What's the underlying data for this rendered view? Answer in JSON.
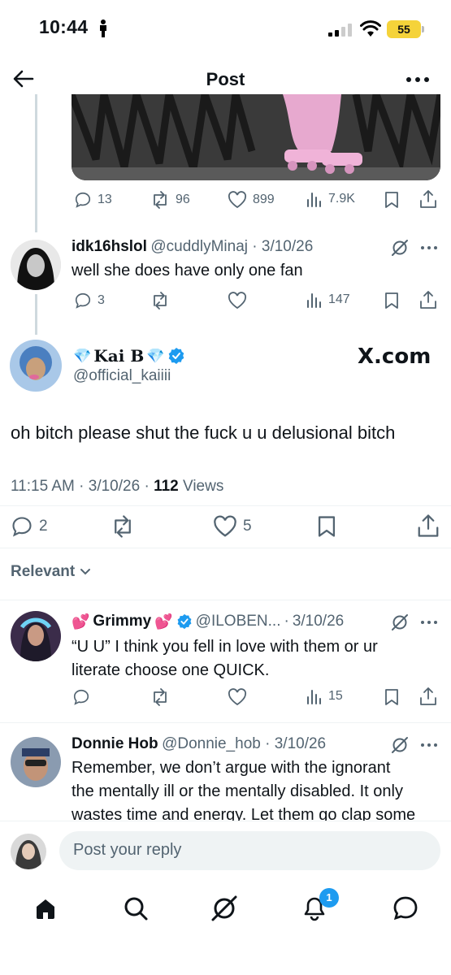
{
  "status_bar": {
    "time": "10:44",
    "battery": "55"
  },
  "nav": {
    "title": "Post"
  },
  "parent_actions": {
    "replies": "13",
    "reposts": "96",
    "likes": "899",
    "views": "7.9K"
  },
  "reply1": {
    "name": "idk16hslol",
    "handle": "@cuddlyMinaj",
    "date": "3/10/26",
    "text": "well she does have only one fan",
    "replies": "3",
    "views": "147"
  },
  "main_post": {
    "name": "Kai B",
    "handle": "@official_kaiiii",
    "watermark": "X.com",
    "text": "oh bitch please shut the fuck u u delusional bitch",
    "time": "11:15 AM",
    "date": "3/10/26",
    "views_count": "112",
    "views_label": "Views",
    "replies": "2",
    "likes": "5"
  },
  "sort": {
    "label": "Relevant"
  },
  "reply2": {
    "name": "Grimmy",
    "handle": "@ILOBEN...",
    "date": "3/10/26",
    "text_line1": "“U U” I think you fell in love with them or ur",
    "text_line2": "literate choose one QUICK.",
    "views": "15"
  },
  "reply3": {
    "name": "Donnie Hob",
    "handle": "@Donnie_hob",
    "date": "3/10/26",
    "text_line1": "Remember, we don’t argue with the ignorant",
    "text_line2": "the mentally ill or the mentally disabled. It only",
    "text_line3": "wastes time and energy. Let them go clap some"
  },
  "composer": {
    "placeholder": "Post your reply"
  },
  "tabbar": {
    "notification_count": "1"
  },
  "colors": {
    "accent": "#1d9bf0",
    "verified": "#1d9bf0",
    "text": "#0f1419",
    "muted": "#536471"
  }
}
